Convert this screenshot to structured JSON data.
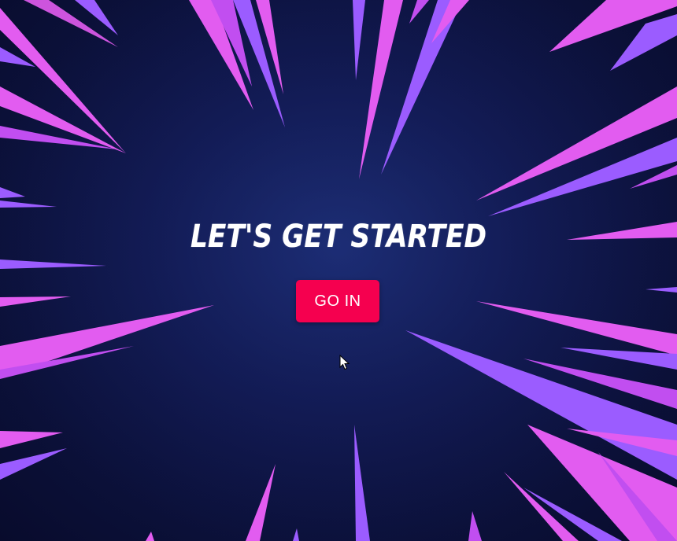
{
  "hero": {
    "headline": "Let's get started",
    "button_label": "GO IN"
  },
  "theme": {
    "background": "#0d1240",
    "button_color": "#f5004f",
    "ray_colors": [
      "#e25cf0",
      "#9b5cff",
      "#6a4dff"
    ]
  },
  "icons": {
    "pointer": "mouse-pointer-icon"
  }
}
